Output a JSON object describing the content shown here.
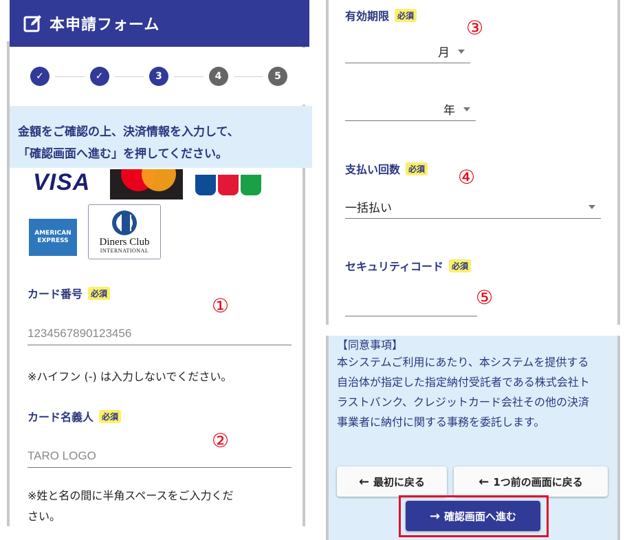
{
  "header": {
    "title": "本申請フォーム",
    "icon": "edit-icon"
  },
  "stepper": {
    "steps": [
      {
        "label": "✓",
        "state": "done"
      },
      {
        "label": "✓",
        "state": "done"
      },
      {
        "label": "3",
        "state": "current"
      },
      {
        "label": "4",
        "state": "todo"
      },
      {
        "label": "5",
        "state": "todo"
      }
    ]
  },
  "notice": {
    "line1": "金額をご確認の上、決済情報を入力して、",
    "line2": "「確認画面へ進む」を押してください。"
  },
  "card_logos": {
    "visa": "VISA",
    "amex_line1": "AMERICAN",
    "amex_line2": "EXPRESS",
    "diners_name": "Diners Club",
    "diners_sub": "INTERNATIONAL"
  },
  "required_badge": "必須",
  "card_number": {
    "label": "カード番号",
    "placeholder": "1234567890123456",
    "help": "※ハイフン (-) は入力しないでください。",
    "marker": "①"
  },
  "card_holder": {
    "label": "カード名義人",
    "placeholder": "TARO LOGO",
    "help_line1": "※姓と名の間に半角スペースをご入力くだ",
    "help_line2": "さい。",
    "marker": "②"
  },
  "expiry": {
    "label": "有効期限",
    "month": "月",
    "year": "年",
    "marker": "③"
  },
  "installments": {
    "label": "支払い回数",
    "value": "一括払い",
    "marker": "④"
  },
  "security_code": {
    "label": "セキュリティコード",
    "marker": "⑤"
  },
  "agreement": {
    "title": "【同意事項】",
    "body": "本システムご利用にあたり、本システムを提供する自治体が指定した指定納付受託者である株式会社トラストバンク、クレジットカード会社その他の決済事業者に納付に関する事務を委託します。"
  },
  "buttons": {
    "first": "最初に戻る",
    "prev": "1つ前の画面に戻る",
    "confirm": "確認画面へ進む"
  },
  "colors": {
    "primary": "#313a96",
    "required_badge": "#fbef6a",
    "notice_bg": "#ddeefa",
    "marker": "#e60012",
    "highlight": "#e0102a"
  }
}
